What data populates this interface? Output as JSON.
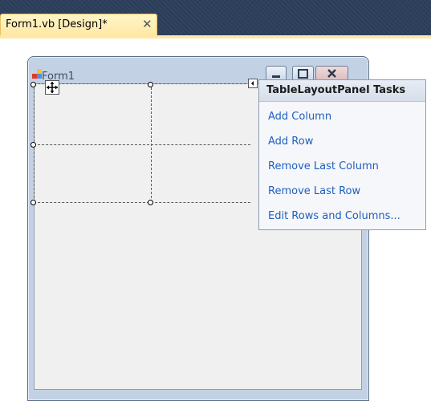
{
  "tab": {
    "label": "Form1.vb [Design]*",
    "close_glyph": "✕"
  },
  "form": {
    "title": "Form1"
  },
  "tasks_panel": {
    "header": "TableLayoutPanel Tasks",
    "items": [
      {
        "label": "Add Column"
      },
      {
        "label": "Add Row"
      },
      {
        "label": "Remove Last Column"
      },
      {
        "label": "Remove Last Row"
      },
      {
        "label": "Edit Rows and Columns..."
      }
    ]
  },
  "icons": {
    "move": "move-icon",
    "smart_tag": "smart-tag-arrow-icon"
  },
  "colors": {
    "tabstrip_bg": "#2b3c59",
    "active_tab": "#ffe8a6",
    "link": "#1e5fbf",
    "form_frame": "#c2d1e4"
  }
}
